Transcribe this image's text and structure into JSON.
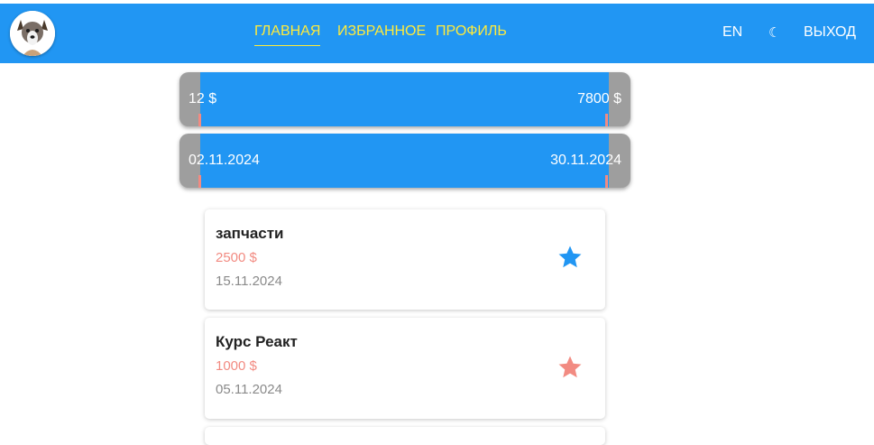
{
  "header": {
    "avatar_icon": "dog-avatar",
    "nav": [
      {
        "label": "ГЛАВНАЯ",
        "active": true
      },
      {
        "label": "ИЗБРАННОЕ",
        "active": false
      },
      {
        "label": "ПРОФИЛЬ",
        "active": false
      }
    ],
    "language": "EN",
    "theme_icon": "☾",
    "logout": "ВЫХОД"
  },
  "filters": {
    "price": {
      "min_label": "12 $",
      "max_label": "7800 $"
    },
    "date": {
      "min_label": "02.11.2024",
      "max_label": "30.11.2024"
    }
  },
  "items": [
    {
      "title": "запчасти",
      "price": "2500 $",
      "date": "15.11.2024",
      "star_color": "#2196f3"
    },
    {
      "title": "Курс Реакт",
      "price": "1000 $",
      "date": "05.11.2024",
      "star_color": "#f28b82"
    }
  ],
  "colors": {
    "accent": "#2196f3",
    "nav_text": "#ffeb3b",
    "price_text": "#f28b82",
    "slider_track": "#9e9e9e"
  }
}
